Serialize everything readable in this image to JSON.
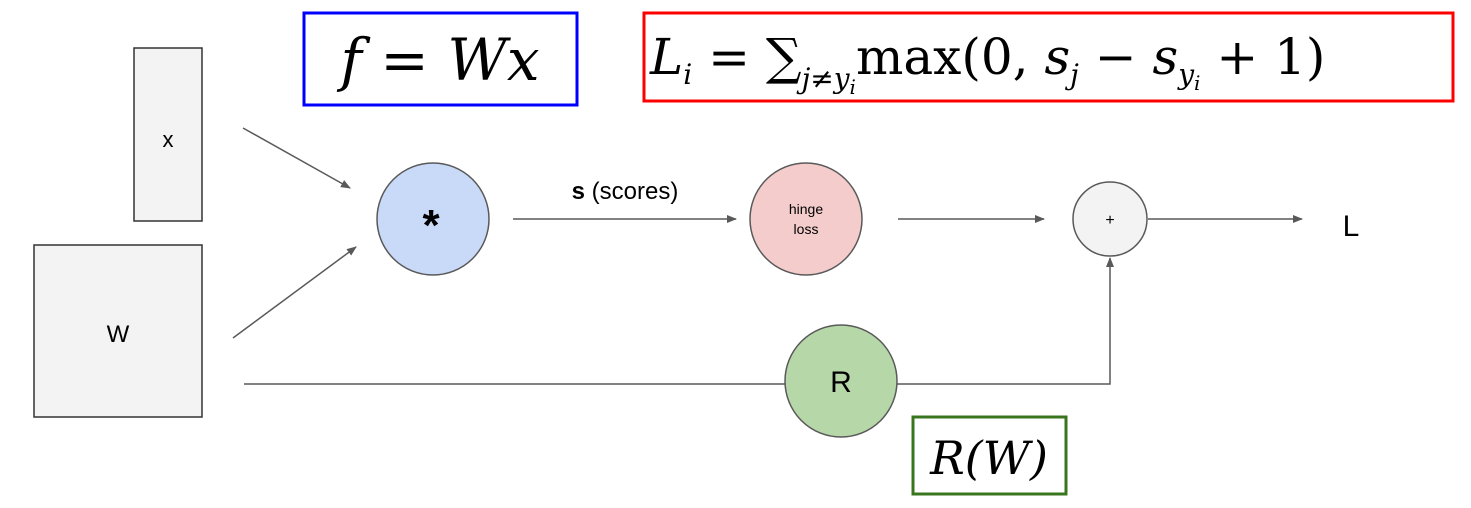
{
  "nodes": {
    "x": "x",
    "W": "W",
    "multiply": "*",
    "hinge_line1": "hinge",
    "hinge_line2": "loss",
    "plus": "+",
    "R": "R",
    "L": "L"
  },
  "edges": {
    "scores_label_bold": "s",
    "scores_label_rest": " (scores)"
  },
  "formulas": {
    "score": {
      "lhs": "f",
      "eq": " = ",
      "rhs": "Wx",
      "border": "#0000ff"
    },
    "loss": {
      "L": "L",
      "i": "i",
      "eq": " = ",
      "sum": "∑",
      "sub": "j≠y",
      "subi": "i",
      "max": "max(0, ",
      "sj": "s",
      "j": "j",
      "minus": " − ",
      "sy": "s",
      "y": "y",
      "yi": "i",
      "tail": " + 1)",
      "border": "#ff0000"
    },
    "reg": {
      "text": "R(W)",
      "border": "#38761d"
    }
  },
  "colors": {
    "multiply_fill": "#c9daf8",
    "hinge_fill": "#f4cccc",
    "plus_fill": "#f3f3f3",
    "R_fill": "#b6d7a8",
    "box_fill": "#f3f3f3"
  }
}
